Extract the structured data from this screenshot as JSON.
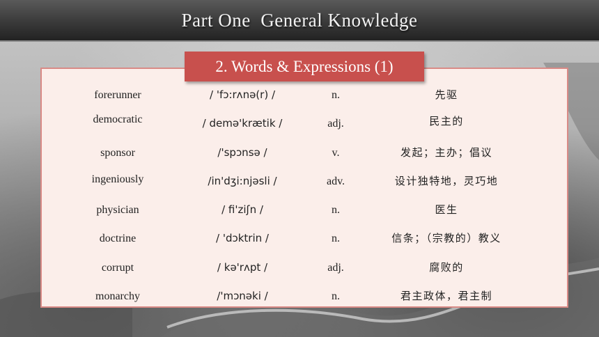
{
  "title": "Part One  General Knowledge",
  "section": "2. Words & Expressions (1)",
  "vocabulary": [
    {
      "word": "forerunner",
      "ipa": "/ 'fɔ:rʌnə(r) /",
      "pos": "n.",
      "meaning": "先驱"
    },
    {
      "word": "democratic",
      "ipa": "/ demə'krætik /",
      "pos": "adj.",
      "meaning": "民主的"
    },
    {
      "word": "sponsor",
      "ipa": "/'spɔnsə /",
      "pos": "v.",
      "meaning": "发起；主办；倡议"
    },
    {
      "word": "ingeniously",
      "ipa": "/in'dʒi:njəsli /",
      "pos": "adv.",
      "meaning": "设计独特地，灵巧地"
    },
    {
      "word": "physician",
      "ipa": "/ fi'ziʃn /",
      "pos": "n.",
      "meaning": "医生"
    },
    {
      "word": "doctrine",
      "ipa": "/ 'dɔktrin /",
      "pos": "n.",
      "meaning": "信条；（宗教的）教义"
    },
    {
      "word": "corrupt",
      "ipa": "/ kə'rʌpt /",
      "pos": "adj.",
      "meaning": "腐败的"
    },
    {
      "word": "monarchy",
      "ipa": "/'mɔnəki /",
      "pos": "n.",
      "meaning": "君主政体，君主制"
    }
  ]
}
